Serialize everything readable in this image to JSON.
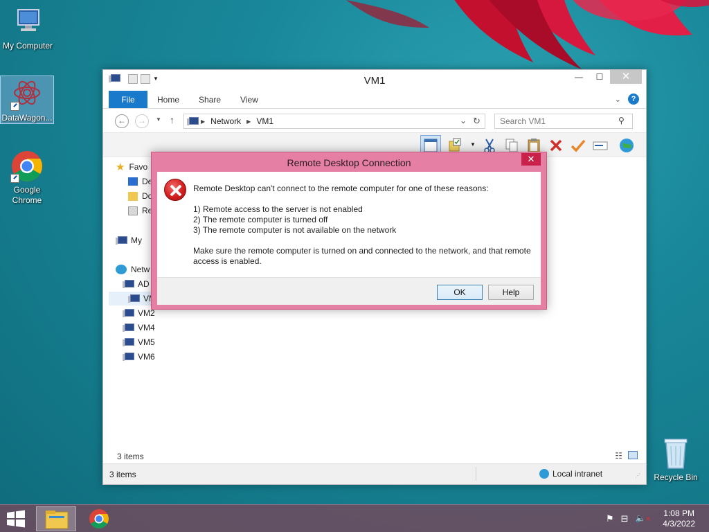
{
  "desktop": {
    "icons": [
      {
        "label": "My Computer"
      },
      {
        "label": "DataWagon..."
      },
      {
        "label": "Google Chrome"
      }
    ],
    "recycle_bin": "Recycle Bin"
  },
  "explorer": {
    "title": "VM1",
    "tabs": [
      "File",
      "Home",
      "Share",
      "View"
    ],
    "address": {
      "segments": [
        "Network",
        "VM1"
      ]
    },
    "search_placeholder": "Search VM1",
    "nav_items": [
      "Favo",
      "De",
      "Do",
      "Re",
      "My",
      "Netw",
      "AD",
      "VM",
      "VM2",
      "VM4",
      "VM5",
      "VM6"
    ],
    "items_count_top": "3 items",
    "status_left": "3 items",
    "status_zone": "Local intranet"
  },
  "dialog": {
    "title": "Remote Desktop Connection",
    "close": "✕",
    "line1": "Remote Desktop can't connect to the remote computer for one of these reasons:",
    "reasons": [
      "1) Remote access to the server is not enabled",
      "2) The remote computer is turned off",
      "3) The remote computer is not available on the network"
    ],
    "advice1": "Make sure the remote computer is turned on and connected to the network, and that remote",
    "advice2": "access is enabled.",
    "ok_label": "OK",
    "help_label": "Help"
  },
  "taskbar": {
    "time": "1:08 PM",
    "date": "4/3/2022"
  },
  "colors": {
    "dialog_frame": "#e57fa3",
    "accent": "#1979ca",
    "error": "#d21f1f"
  }
}
